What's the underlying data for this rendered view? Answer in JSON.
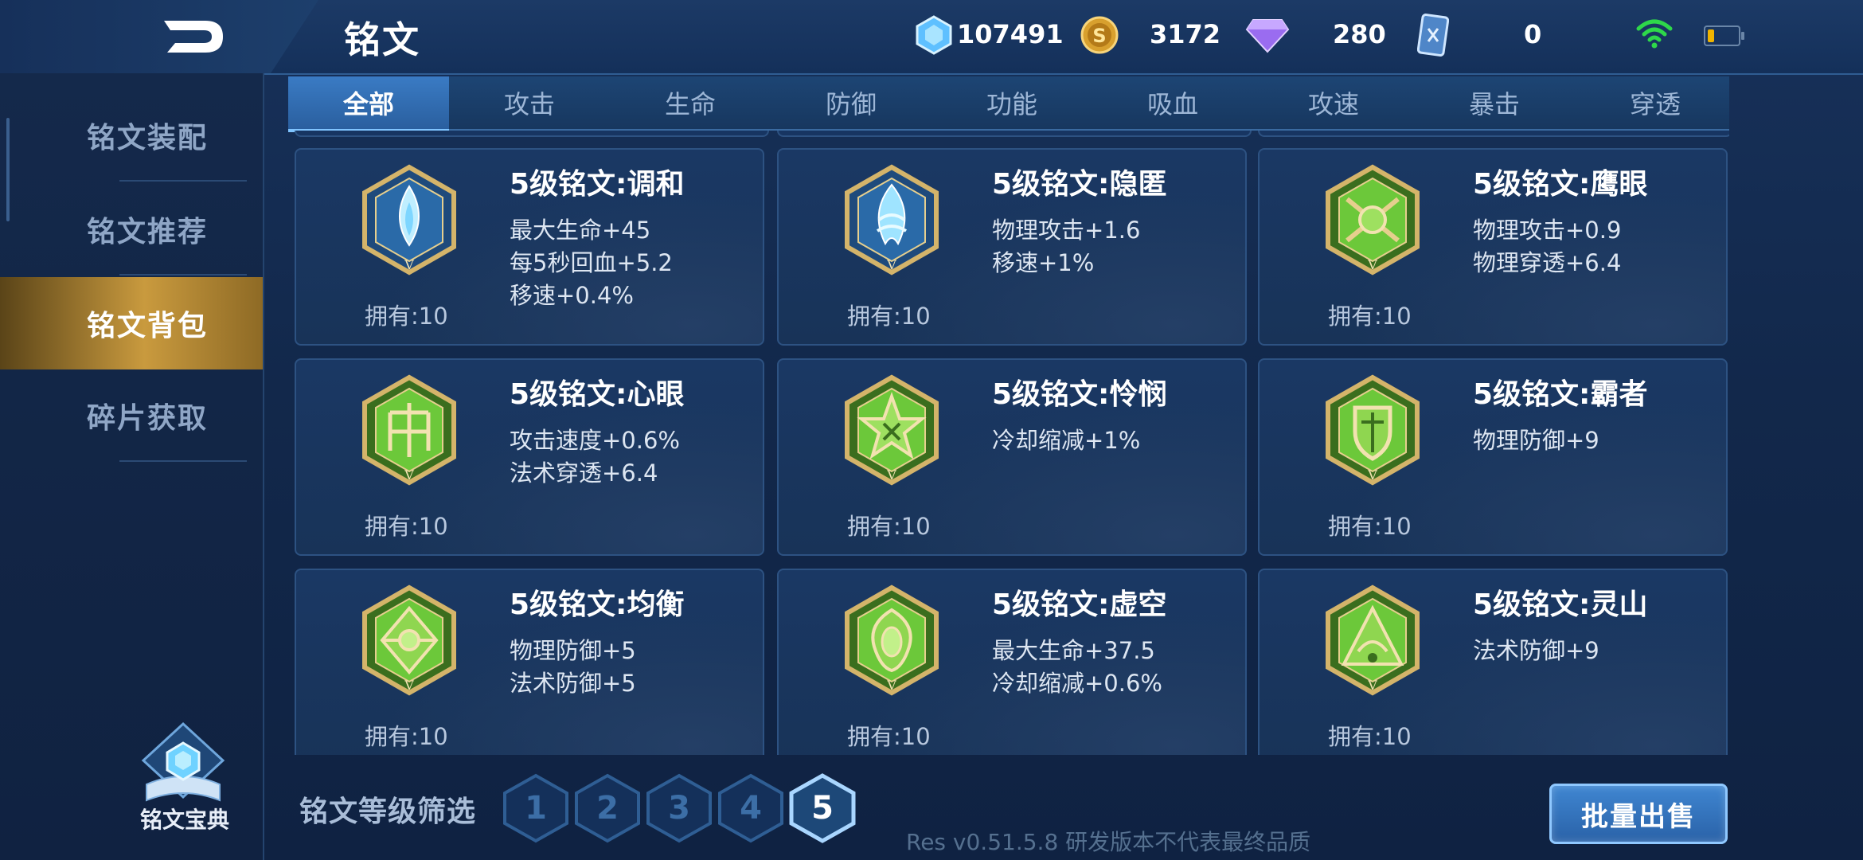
{
  "header": {
    "title": "铭文",
    "resources": [
      {
        "name": "diamond-icon",
        "value": "107491"
      },
      {
        "name": "gold-coin-icon",
        "value": "3172"
      },
      {
        "name": "gem-icon",
        "value": "280"
      },
      {
        "name": "card-icon",
        "value": "0"
      }
    ]
  },
  "sidebar": {
    "items": [
      {
        "label": "铭文装配",
        "active": false
      },
      {
        "label": "铭文推荐",
        "active": false
      },
      {
        "label": "铭文背包",
        "active": true
      },
      {
        "label": "碎片获取",
        "active": false
      }
    ],
    "codex_label": "铭文宝典"
  },
  "tabs": [
    "全部",
    "攻击",
    "生命",
    "防御",
    "功能",
    "吸血",
    "攻速",
    "暴击",
    "穿透"
  ],
  "active_tab": "全部",
  "cards": [
    {
      "name": "5级铭文:调和",
      "stats": [
        "最大生命+45",
        "每5秒回血+5.2",
        "移速+0.4%"
      ],
      "owned": "拥有:10",
      "color": "blue"
    },
    {
      "name": "5级铭文:隐匿",
      "stats": [
        "物理攻击+1.6",
        "移速+1%"
      ],
      "owned": "拥有:10",
      "color": "blue"
    },
    {
      "name": "5级铭文:鹰眼",
      "stats": [
        "物理攻击+0.9",
        "物理穿透+6.4"
      ],
      "owned": "拥有:10",
      "color": "green"
    },
    {
      "name": "5级铭文:心眼",
      "stats": [
        "攻击速度+0.6%",
        "法术穿透+6.4"
      ],
      "owned": "拥有:10",
      "color": "green"
    },
    {
      "name": "5级铭文:怜悯",
      "stats": [
        "冷却缩减+1%"
      ],
      "owned": "拥有:10",
      "color": "green"
    },
    {
      "name": "5级铭文:霸者",
      "stats": [
        "物理防御+9"
      ],
      "owned": "拥有:10",
      "color": "green"
    },
    {
      "name": "5级铭文:均衡",
      "stats": [
        "物理防御+5",
        "法术防御+5"
      ],
      "owned": "拥有:10",
      "color": "green"
    },
    {
      "name": "5级铭文:虚空",
      "stats": [
        "最大生命+37.5",
        "冷却缩减+0.6%"
      ],
      "owned": "拥有:10",
      "color": "green"
    },
    {
      "name": "5级铭文:灵山",
      "stats": [
        "法术防御+9"
      ],
      "owned": "拥有:10",
      "color": "green"
    }
  ],
  "filter": {
    "label": "铭文等级筛选",
    "levels": [
      "1",
      "2",
      "3",
      "4",
      "5"
    ],
    "active_level": "5"
  },
  "sell_button": "批量出售",
  "version_text": "Res v0.51.5.8 研发版本不代表最终品质",
  "colors": {
    "accent_gold": "#c99a3e",
    "tab_active": "#3a7bc4",
    "card_bg": "#1a3864",
    "rune_green": "#6cc83a",
    "rune_blue": "#7ed6ff"
  }
}
